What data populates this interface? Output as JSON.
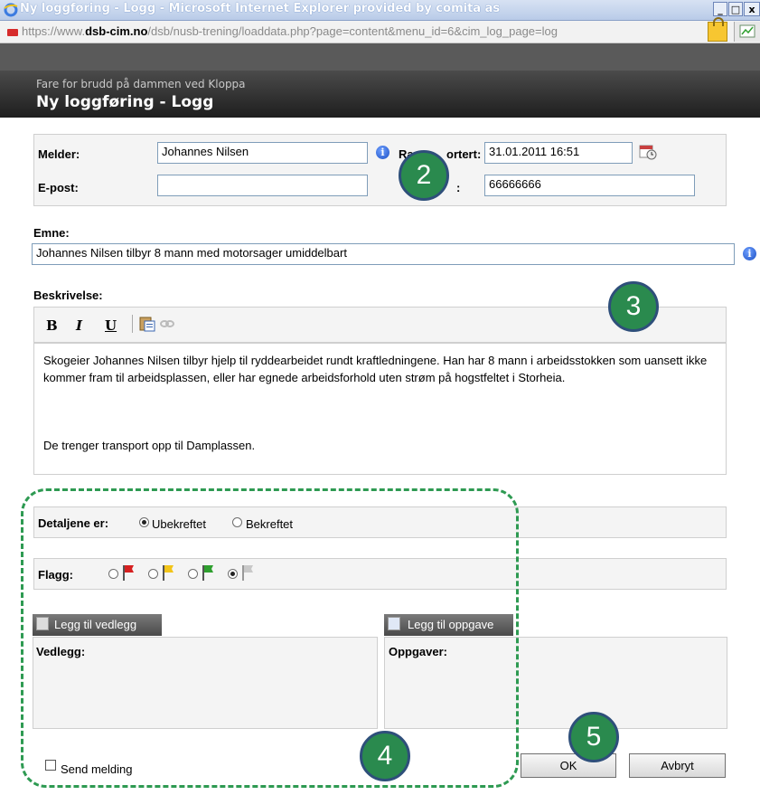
{
  "window": {
    "title": "Ny loggføring - Logg - Microsoft Internet Explorer provided by comita as",
    "minimize": "_",
    "maximize": "□",
    "close": "x"
  },
  "address": {
    "scheme": "https://www.",
    "host": "dsb-cim.no",
    "path": "/dsb/nusb-trening/loaddata.php?page=content&menu_id=6&cim_log_page=log"
  },
  "dialog": {
    "subtitle": "Fare for brudd på dammen ved Kloppa",
    "title": "Ny loggføring - Logg"
  },
  "reporter": {
    "melder_label": "Melder:",
    "melder_value": "Johannes Nilsen",
    "rapportert_label_left": "Ra",
    "rapportert_label_right": "ortert:",
    "rapportert_value": "31.01.2011 16:51",
    "epost_label": "E-post:",
    "epost_value": "",
    "phone_suffix": ":",
    "phone_value": "66666666"
  },
  "subject": {
    "label": "Emne:",
    "value": "Johannes Nilsen tilbyr 8 mann med motorsager umiddelbart"
  },
  "description": {
    "label": "Beskrivelse:",
    "bold": "B",
    "italic": "I",
    "underline": "U",
    "paragraph1": "Skogeier Johannes Nilsen tilbyr hjelp til ryddearbeidet rundt kraftledningene. Han har 8 mann i arbeidsstokken som uansett ikke kommer fram til arbeidsplassen, eller har egnede arbeidsforhold uten strøm på hogstfeltet i Storheia.",
    "paragraph2": "De trenger transport opp til Damplassen."
  },
  "details": {
    "label": "Detaljene er:",
    "option_unconfirmed": "Ubekreftet",
    "option_confirmed": "Bekreftet",
    "selected": "Ubekreftet"
  },
  "flags": {
    "label": "Flagg:",
    "options": [
      "red-flag-icon",
      "yellow-flag-icon",
      "green-flag-icon",
      "grey-flag-icon"
    ],
    "colors": [
      "#d62020",
      "#f2c419",
      "#2fa02f",
      "#c8c8c8"
    ],
    "selected_index": 3
  },
  "attachments": {
    "add_label": "Legg til vedlegg",
    "heading": "Vedlegg:"
  },
  "tasks": {
    "add_label": "Legg til oppgave",
    "heading": "Oppgaver:"
  },
  "footer": {
    "send_label": "Send melding",
    "ok_label": "OK",
    "cancel_label": "Avbryt"
  },
  "callouts": [
    "2",
    "3",
    "4",
    "5"
  ],
  "accent_colors": {
    "callout_fill": "#2a8a4e",
    "callout_border": "#2e4f7a",
    "dashed_outline": "#2e9a52"
  }
}
